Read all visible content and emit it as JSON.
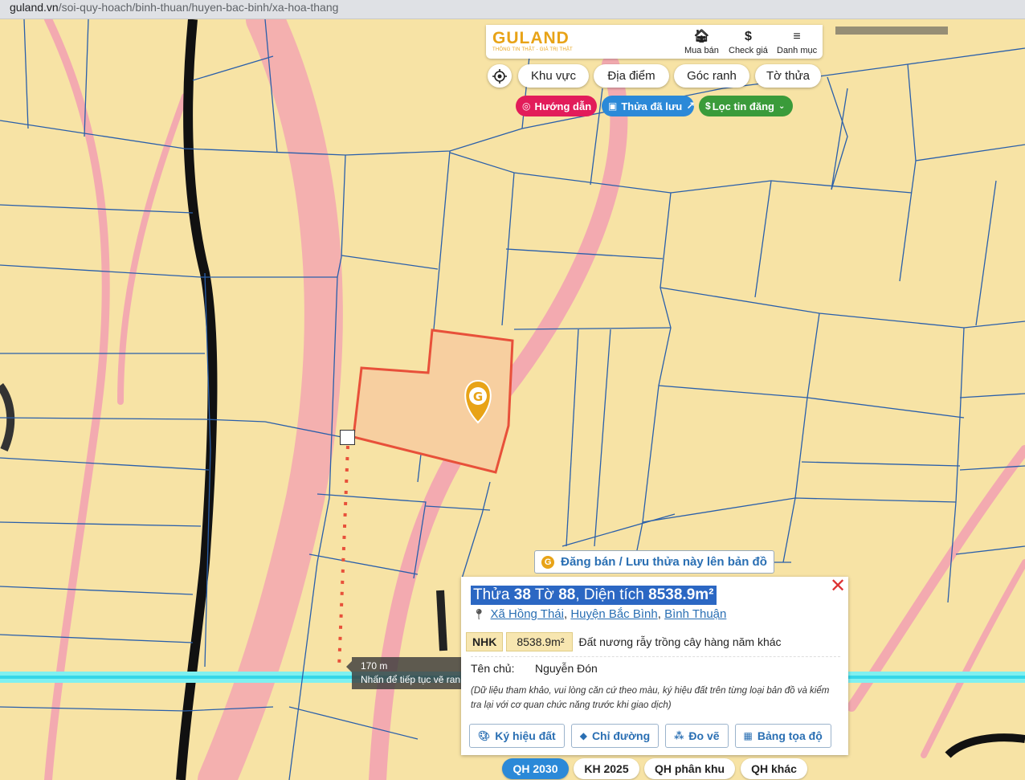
{
  "browser": {
    "url_domain": "guland.vn",
    "url_path": "/soi-quy-hoach/binh-thuan/huyen-bac-binh/xa-hoa-thang"
  },
  "header": {
    "logo_text": "GULAND",
    "logo_tagline": "THÔNG TIN THẬT - GIÁ TRỊ THẬT",
    "nav": [
      {
        "label": "Mua bán",
        "icon": "building-icon"
      },
      {
        "label": "Check giá",
        "icon": "dollar-icon"
      },
      {
        "label": "Danh mục",
        "icon": "menu-icon"
      }
    ]
  },
  "filters": [
    "Khu vực",
    "Địa điểm",
    "Góc ranh",
    "Tờ thửa"
  ],
  "chips": [
    {
      "label": "Hướng dẫn",
      "color": "#e21c5a",
      "icon": "target-icon"
    },
    {
      "label": "Thửa đã lưu",
      "color": "#2b89d8",
      "icon": "bookmark-icon"
    },
    {
      "label": "Lọc tin đăng",
      "color": "#3a9b3a",
      "icon": "dollar-icon"
    }
  ],
  "post_button_label": "Đăng bán / Lưu thửa này lên bản đồ",
  "parcel": {
    "title_pre": "Thửa",
    "plot_no": "38",
    "title_mid": "Tờ",
    "sheet_no": "88",
    "title_area_label": ", Diện tích",
    "area": "8538.9m²",
    "address": [
      "Xã Hồng Thái",
      "Huyện Bắc Bình",
      "Bình Thuận"
    ],
    "land_code": "NHK",
    "land_area": "8538.9m²",
    "land_desc": "Đất nương rẫy trồng cây hàng năm khác",
    "owner_label": "Tên chủ:",
    "owner_name": "Nguyễn Đón",
    "note": "(Dữ liệu tham khảo, vui lòng căn cứ theo màu, ký hiệu đất trên từng loại bản đồ và kiểm tra lại với cơ quan chức năng trước khi giao dịch)",
    "actions": [
      "Ký hiệu đất",
      "Chỉ đường",
      "Đo vẽ",
      "Bảng tọa độ"
    ]
  },
  "measure": {
    "distance": "170 m",
    "hint": "Nhấn để tiếp tục vẽ ranh"
  },
  "plan_tabs": [
    {
      "label": "QH 2030",
      "active": true
    },
    {
      "label": "KH 2025",
      "active": false
    },
    {
      "label": "QH phân khu",
      "active": false
    },
    {
      "label": "QH khác",
      "active": false
    }
  ],
  "colors": {
    "brand": "#e8a317",
    "link": "#2a6fb3",
    "parcel_fill": "#f7cfa0",
    "parcel_stroke": "#e8503a"
  }
}
